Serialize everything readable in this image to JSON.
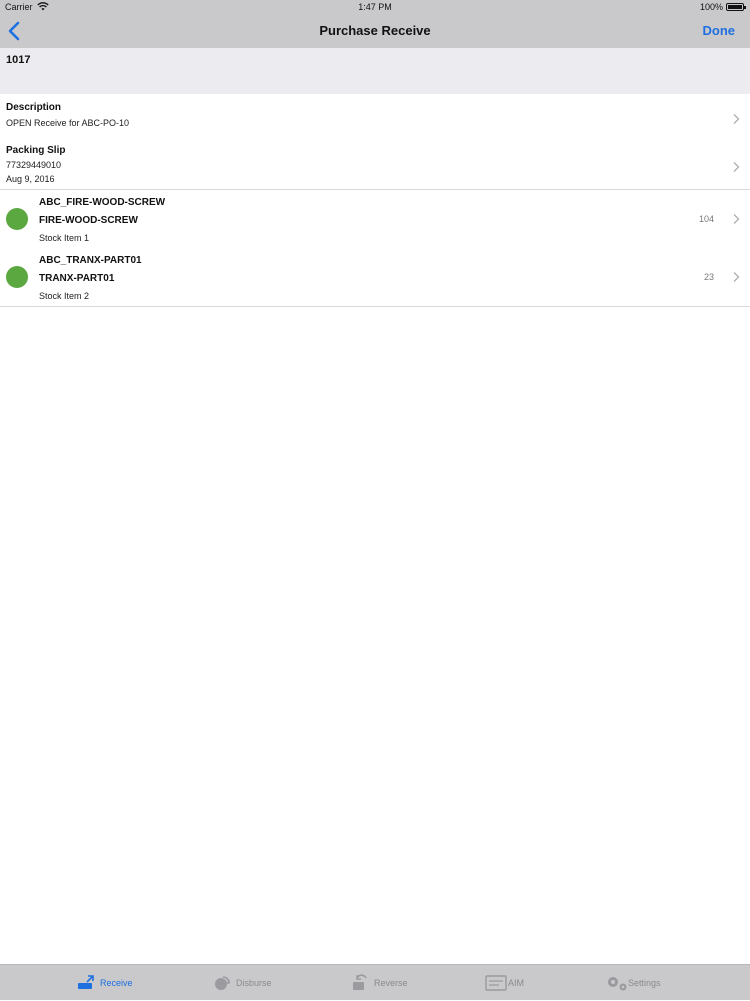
{
  "status_bar": {
    "carrier": "Carrier",
    "time": "1:47 PM",
    "battery": "100%"
  },
  "nav": {
    "title": "Purchase Receive",
    "done_label": "Done",
    "back_icon": "chevron-left-icon"
  },
  "header": {
    "po_number": "1017"
  },
  "description": {
    "label": "Description",
    "value": "OPEN Receive for ABC-PO-10"
  },
  "packing_slip": {
    "label": "Packing Slip",
    "number": "77329449010",
    "date": "Aug 9, 2016"
  },
  "items": [
    {
      "code": "ABC_FIRE-WOOD-SCREW",
      "name": "FIRE-WOOD-SCREW",
      "stock_label": "Stock Item 1",
      "qty": "104",
      "status_color": "#5aa83f"
    },
    {
      "code": "ABC_TRANX-PART01",
      "name": "TRANX-PART01",
      "stock_label": "Stock Item 2",
      "qty": "23",
      "status_color": "#5aa83f"
    }
  ],
  "tabs": [
    {
      "label": "Receive",
      "icon": "receive-icon",
      "active": true
    },
    {
      "label": "Disburse",
      "icon": "disburse-icon",
      "active": false
    },
    {
      "label": "Reverse",
      "icon": "reverse-icon",
      "active": false
    },
    {
      "label": "AIM",
      "icon": "aim-icon",
      "active": false
    },
    {
      "label": "Settings",
      "icon": "gear-icon",
      "active": false
    }
  ],
  "colors": {
    "accent": "#1e6fe0",
    "bar": "#c9c9cc",
    "status_green": "#5aa83f"
  }
}
